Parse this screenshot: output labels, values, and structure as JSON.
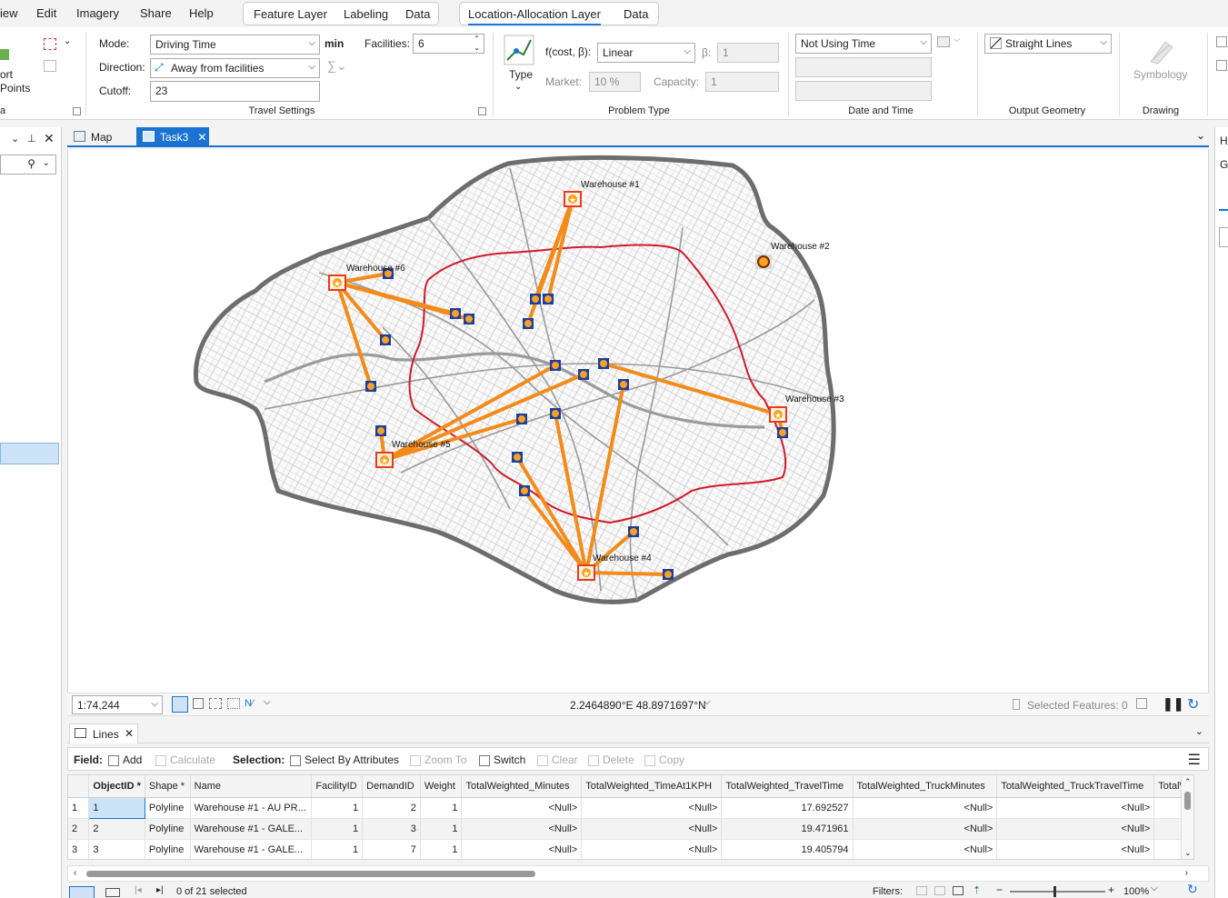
{
  "menu": {
    "items": [
      "iew",
      "Edit",
      "Imagery",
      "Share",
      "Help"
    ],
    "context1": [
      "Feature Layer",
      "Labeling",
      "Data"
    ],
    "context2": [
      "Location-Allocation Layer",
      "Data"
    ]
  },
  "ribbon": {
    "left_partial": {
      "line1": "ort",
      "line2": "Points",
      "line3": "a"
    },
    "mode_label": "Mode:",
    "mode_value": "Driving Time",
    "mode_unit": "min",
    "direction_label": "Direction:",
    "direction_value": "Away from facilities",
    "cutoff_label": "Cutoff:",
    "cutoff_value": "23",
    "facilities_label": "Facilities:",
    "facilities_value": "6",
    "travel_settings_title": "Travel Settings",
    "type_label": "Type",
    "fcost_label": "f(cost, β):",
    "fcost_value": "Linear",
    "beta_label": "β:",
    "beta_value": "1",
    "market_label": "Market:",
    "market_value": "10  %",
    "capacity_label": "Capacity:",
    "capacity_value": "1",
    "problem_type_title": "Problem Type",
    "time_value": "Not Using Time",
    "date_time_title": "Date and Time",
    "geometry_value": "Straight Lines",
    "output_geometry_title": "Output Geometry",
    "symbology_label": "Symbology",
    "drawing_title": "Drawing"
  },
  "doc_tabs": [
    "Map",
    "Task3"
  ],
  "map": {
    "warehouses": [
      "Warehouse #1",
      "Warehouse #2",
      "Warehouse #3",
      "Warehouse #4",
      "Warehouse #5",
      "Warehouse #6"
    ],
    "scale": "1:74,244",
    "coordinates": "2.2464890°E 48.8971697°N",
    "selected_features": "Selected Features: 0"
  },
  "table": {
    "tab_label": "Lines",
    "field_label": "Field:",
    "add_label": "Add",
    "calculate_label": "Calculate",
    "selection_label": "Selection:",
    "select_by_attr": "Select By Attributes",
    "zoom_to": "Zoom To",
    "switch": "Switch",
    "clear": "Clear",
    "delete": "Delete",
    "copy": "Copy",
    "columns": [
      "ObjectID *",
      "Shape *",
      "Name",
      "FacilityID",
      "DemandID",
      "Weight",
      "TotalWeighted_Minutes",
      "TotalWeighted_TimeAt1KPH",
      "TotalWeighted_TravelTime",
      "TotalWeighted_TruckMinutes",
      "TotalWeighted_TruckTravelTime",
      "TotalW"
    ],
    "rows": [
      [
        "1",
        "1",
        "Polyline",
        "Warehouse #1 - AU PR...",
        "1",
        "2",
        "1",
        "<Null>",
        "<Null>",
        "17.692527",
        "<Null>",
        "<Null>"
      ],
      [
        "2",
        "2",
        "Polyline",
        "Warehouse #1 - GALE...",
        "1",
        "3",
        "1",
        "<Null>",
        "<Null>",
        "19.471961",
        "<Null>",
        "<Null>"
      ],
      [
        "3",
        "3",
        "Polyline",
        "Warehouse #1 - GALE...",
        "1",
        "7",
        "1",
        "<Null>",
        "<Null>",
        "19.405794",
        "<Null>",
        "<Null>"
      ]
    ],
    "selected_count": "0 of 21 selected",
    "filters_label": "Filters:",
    "zoom_pct": "100%"
  }
}
